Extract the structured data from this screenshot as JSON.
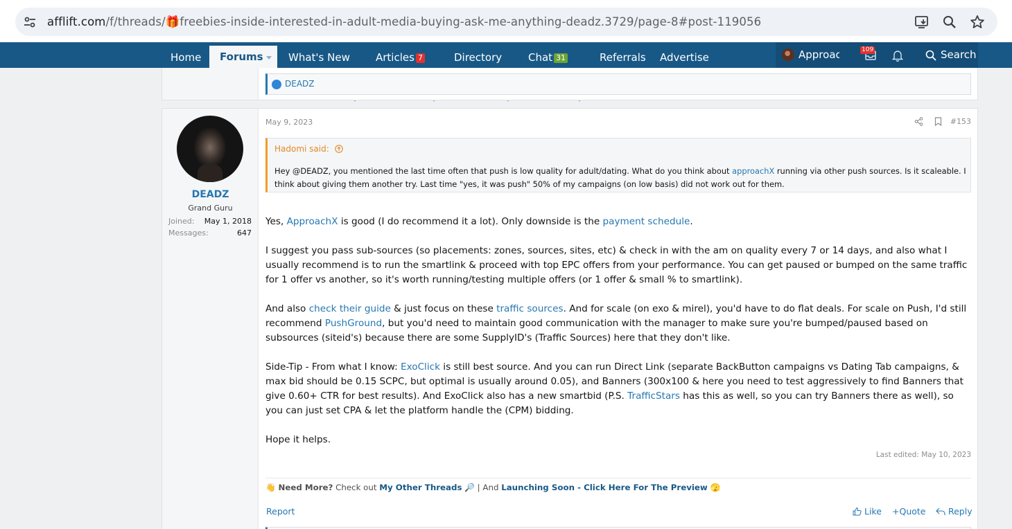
{
  "browser": {
    "url_host": "afflift.com",
    "url_path": "/f/threads/🎁freebies-inside-interested-in-adult-media-buying-ask-me-anything-deadz.3729/page-8#post-119056"
  },
  "nav": {
    "home": "Home",
    "forums": "Forums",
    "whats_new": "What's New",
    "articles": "Articles",
    "articles_badge": "7",
    "directory": "Directory",
    "chat": "Chat",
    "chat_badge": "31",
    "referrals": "Referrals",
    "advertise": "Advertise",
    "user": "ApproachX",
    "alerts_badge": "109",
    "search": "Search"
  },
  "prev_post": {
    "reaction_user": "DEADZ"
  },
  "post": {
    "user": {
      "name": "DEADZ",
      "title": "Grand Guru",
      "joined_label": "Joined:",
      "joined_value": "May 1, 2018",
      "messages_label": "Messages:",
      "messages_value": "647"
    },
    "date": "May 9, 2023",
    "number": "#153",
    "quote": {
      "author": "Hadomi said:",
      "text_1": "Hey @DEADZ, you mentioned the last time often that push is low quality for adult/dating. What do you think about ",
      "link_1": "approachX",
      "text_2": " running via other push sources. Is it scaleable. I think about giving them another try. Last time \"yes, it was push\" 50% of my campaigns (on low basis) did not work out for them."
    },
    "p1": {
      "a": "Yes, ",
      "link_1": "ApproachX",
      "b": " is good (I do recommend it a lot). Only downside is the ",
      "link_2": "payment schedule",
      "c": "."
    },
    "p2": "I suggest you pass sub-sources (so placements: zones, sources, sites, etc) & check in with the am on quality every 7 or 14 days, and also what I usually recommend is to run the smartlink & proceed with top EPC offers from your performance. You can get paused or bumped on the same traffic for 1 offer vs another, so it's worth running/testing multiple offers (or 1 offer & small % to smartlink).",
    "p3": {
      "a": "And also ",
      "link_1": "check their guide",
      "b": " & just focus on these ",
      "link_2": "traffic sources",
      "c": ". And for scale (on exo & mirel), you'd have to do flat deals. For scale on Push, I'd still recommend ",
      "link_3": "PushGround",
      "d": ", but you'd need to maintain good communication with the manager to make sure you're bumped/paused based on subsources (siteid's) because there are some SupplyID's (Traffic Sources) here that they don't like."
    },
    "p4": {
      "a": "Side-Tip - From what I know: ",
      "link_1": "ExoClick",
      "b": " is still best source. And you can run Direct Link (separate BackButton campaigns vs Dating Tab campaigns, & max bid should be 0.15 SCPC, but optimal is usually around 0.05), and Banners (300x100 & here you need to test aggressively to find Banners that give 0.60+ CTR for best results). And ExoClick also has a new smartbid (P.S. ",
      "link_2": "TrafficStars",
      "c": " has this as well, so you can try Banners there as well), so you can just set CPA & let the platform handle the (CPM) bidding."
    },
    "p5": "Hope it helps.",
    "last_edited": "Last edited: May 10, 2023",
    "signature": {
      "emoji_wave": "👋",
      "need_more": "Need More?",
      "check_out": " Check out ",
      "my_threads": "My Other Threads",
      "emoji_search": "🔎",
      "sep": " | And ",
      "launching": "Launching Soon - Click Here For The Preview",
      "emoji_face": "🫣"
    },
    "actions": {
      "report": "Report",
      "like": "Like",
      "quote": "Quote",
      "reply": "Reply"
    }
  }
}
